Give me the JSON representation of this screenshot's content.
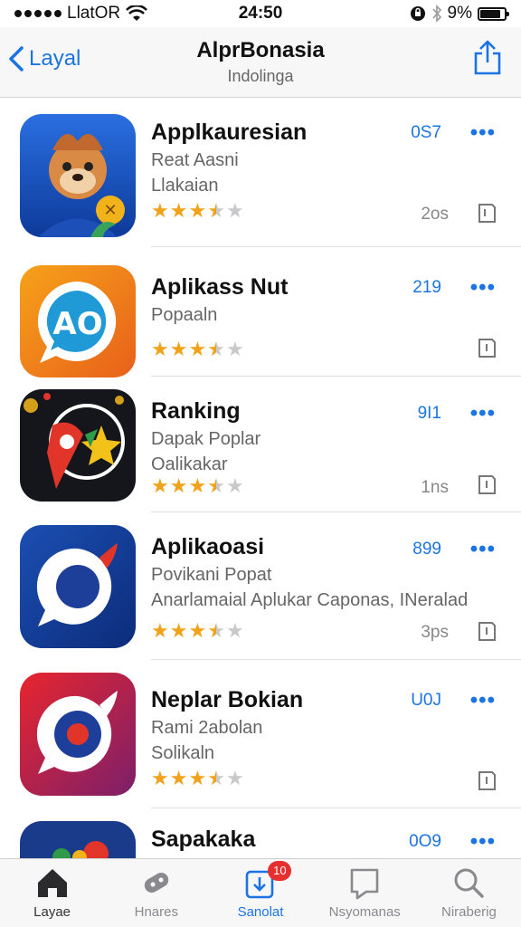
{
  "status": {
    "carrier": "LlatOR",
    "time": "24:50",
    "battery": "9%",
    "battery_level": 0.85
  },
  "nav": {
    "back_label": "Layal",
    "title": "AlprBonasia",
    "subtitle": "Indolinga"
  },
  "apps": [
    {
      "name": "Applkauresian",
      "line1": "Reat Aasni",
      "line2": "Llakaian",
      "price": "0S7",
      "size": "2os",
      "rating": 3.5
    },
    {
      "name": "Aplikass Nut",
      "line1": "Popaaln",
      "line2": "",
      "price": "219",
      "size": "",
      "rating": 3.5
    },
    {
      "name": "Ranking",
      "line1": "Dapak Poplar",
      "line2": "Oalikakar",
      "price": "9I1",
      "size": "1ns",
      "rating": 3.5
    },
    {
      "name": "Aplikaoasi",
      "line1": "Povikani Popat",
      "line2": "Anarlamaial Aplukar Caponas, INeralad",
      "price": "899",
      "size": "3ps",
      "rating": 3.5
    },
    {
      "name": "Neplar Bokian",
      "line1": "Rami 2abolan",
      "line2": "Solikaln",
      "price": "U0J",
      "size": "",
      "rating": 3.5
    },
    {
      "name": "Sapakaka",
      "line1": "",
      "line2": "",
      "price": "0O9",
      "size": "",
      "rating": 0
    }
  ],
  "tabs": [
    {
      "label": "Layae",
      "icon": "home-icon"
    },
    {
      "label": "Hnares",
      "icon": "games-icon"
    },
    {
      "label": "Sanolat",
      "icon": "updates-icon",
      "badge": "10"
    },
    {
      "label": "Nsyomanas",
      "icon": "apps-icon"
    },
    {
      "label": "Niraberig",
      "icon": "search-icon"
    }
  ],
  "colors": {
    "accent": "#1b74e4",
    "star": "#f0a21a",
    "badge": "#e63030"
  }
}
